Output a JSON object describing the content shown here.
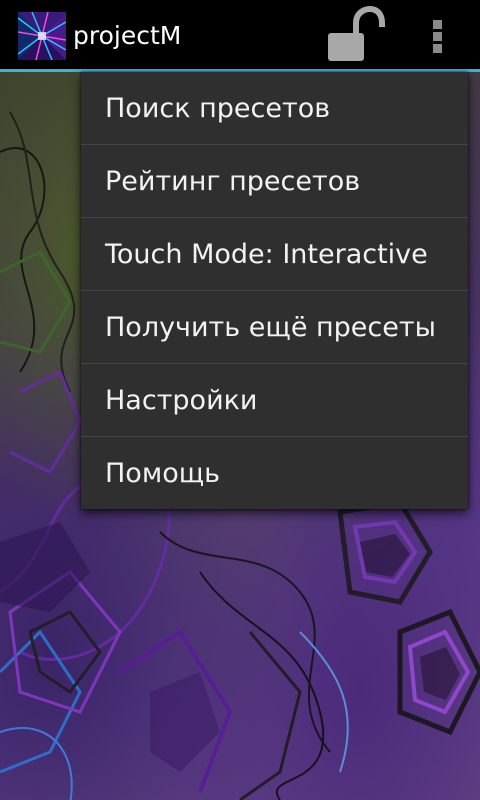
{
  "action_bar": {
    "title": "projectM",
    "app_icon": "projectm-app-icon",
    "lock_icon": "unlocked-padlock-icon",
    "overflow_icon": "overflow-menu-icon",
    "accent_color": "#33b5e5"
  },
  "overflow_menu": {
    "items": [
      {
        "label": "Поиск пресетов"
      },
      {
        "label": "Рейтинг пресетов"
      },
      {
        "label": "Touch Mode: Interactive"
      },
      {
        "label": "Получить ещё пресеты"
      },
      {
        "label": "Настройки"
      },
      {
        "label": "Помощь"
      }
    ]
  }
}
